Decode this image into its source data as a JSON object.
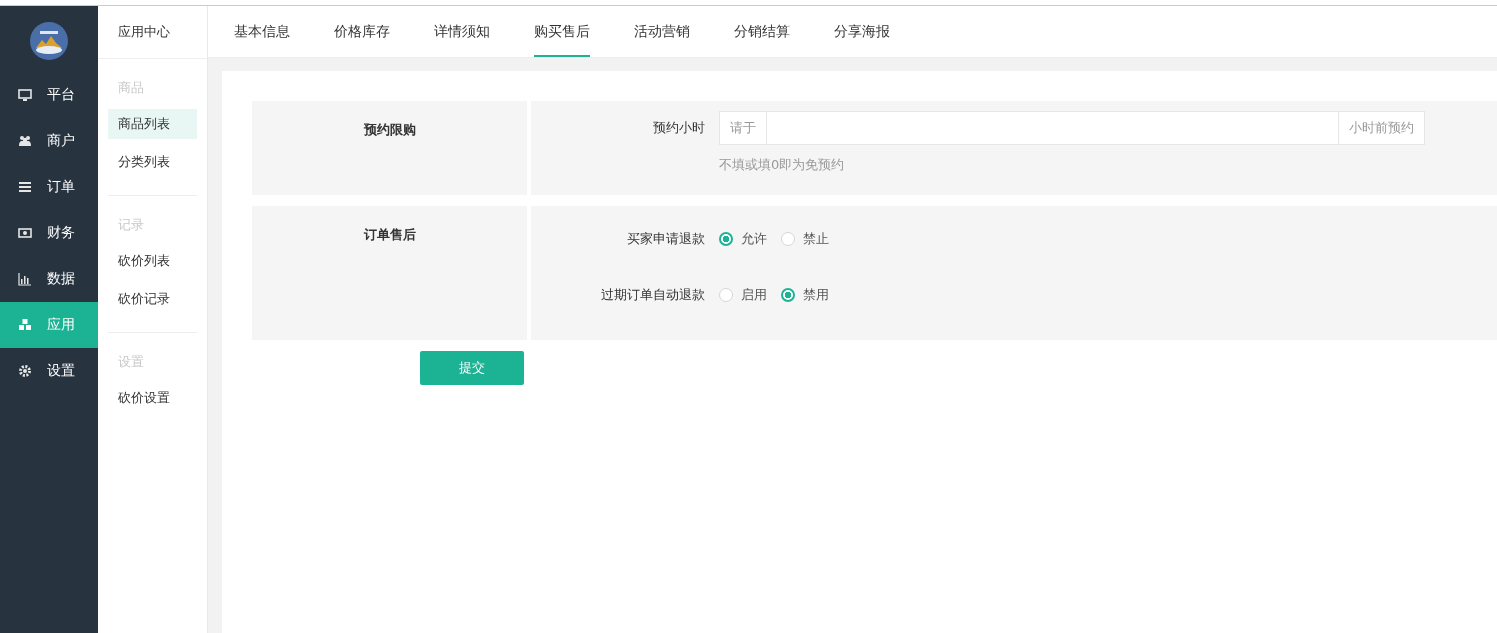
{
  "sidebar": {
    "items": [
      {
        "label": "平台",
        "selected": false
      },
      {
        "label": "商户",
        "selected": false
      },
      {
        "label": "订单",
        "selected": false
      },
      {
        "label": "财务",
        "selected": false
      },
      {
        "label": "数据",
        "selected": false
      },
      {
        "label": "应用",
        "selected": true
      },
      {
        "label": "设置",
        "selected": false
      }
    ]
  },
  "subnav": {
    "title": "应用中心",
    "groups": [
      {
        "heading": "商品",
        "items": [
          {
            "label": "商品列表",
            "selected": true
          },
          {
            "label": "分类列表",
            "selected": false
          }
        ]
      },
      {
        "heading": "记录",
        "items": [
          {
            "label": "砍价列表",
            "selected": false
          },
          {
            "label": "砍价记录",
            "selected": false
          }
        ]
      },
      {
        "heading": "设置",
        "items": [
          {
            "label": "砍价设置",
            "selected": false
          }
        ]
      }
    ]
  },
  "tabs": [
    {
      "label": "基本信息",
      "selected": false
    },
    {
      "label": "价格库存",
      "selected": false
    },
    {
      "label": "详情须知",
      "selected": false
    },
    {
      "label": "购买售后",
      "selected": true
    },
    {
      "label": "活动营销",
      "selected": false
    },
    {
      "label": "分销结算",
      "selected": false
    },
    {
      "label": "分享海报",
      "selected": false
    }
  ],
  "form": {
    "sections": [
      {
        "title": "预约限购",
        "fields": [
          {
            "kind": "input",
            "label": "预约小时",
            "prefix": "请于",
            "suffix": "小时前预约",
            "hint": "不填或填0即为免预约"
          }
        ]
      },
      {
        "title": "订单售后",
        "fields": [
          {
            "kind": "radio",
            "label": "买家申请退款",
            "options": [
              {
                "label": "允许",
                "selected": true
              },
              {
                "label": "禁止",
                "selected": false
              }
            ]
          },
          {
            "kind": "radio",
            "label": "过期订单自动退款",
            "options": [
              {
                "label": "启用",
                "selected": false
              },
              {
                "label": "禁用",
                "selected": true
              }
            ]
          }
        ]
      }
    ]
  },
  "submit": "提交"
}
